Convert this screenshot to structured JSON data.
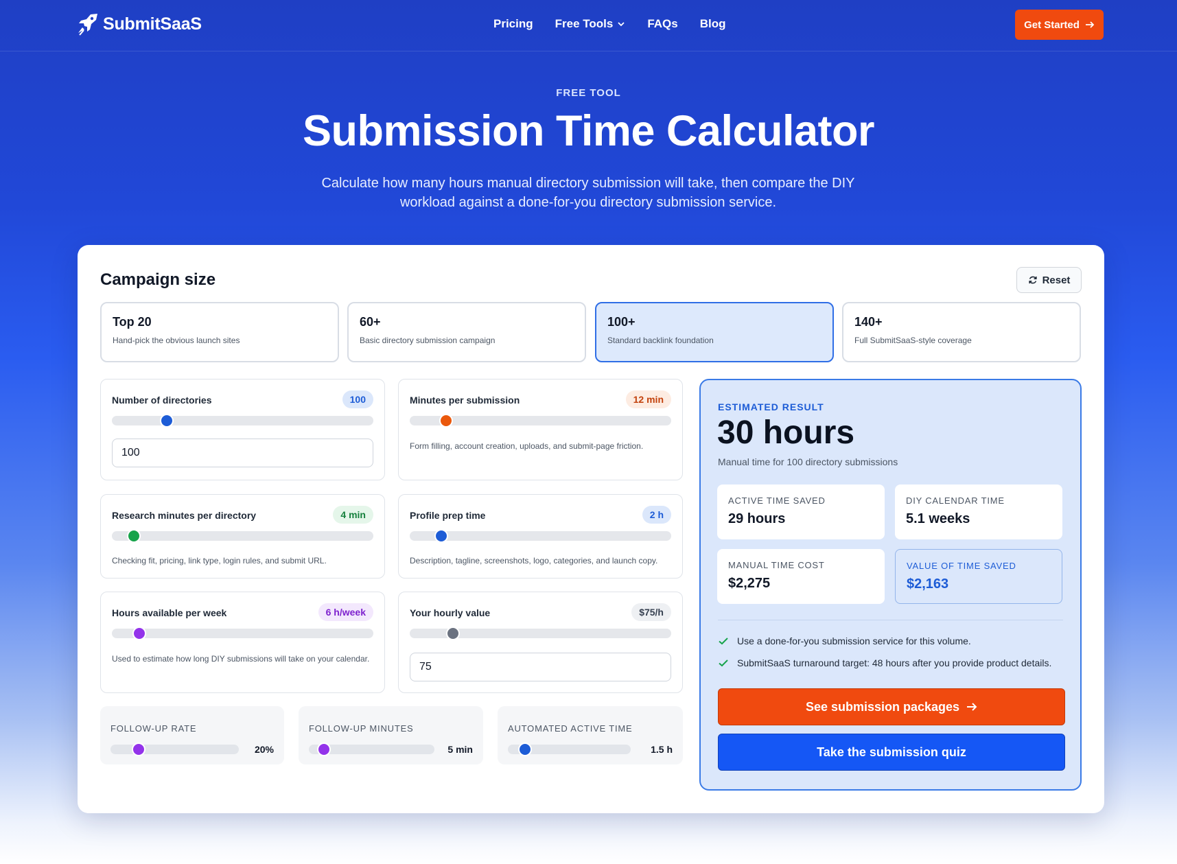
{
  "nav": {
    "logo_text": "SubmitSaaS",
    "links": [
      "Pricing",
      "Free Tools",
      "FAQs",
      "Blog"
    ],
    "cta": "Get Started"
  },
  "hero": {
    "eyebrow": "FREE TOOL",
    "title": "Submission Time Calculator",
    "subtitle": "Calculate how many hours manual directory submission will take, then compare the DIY workload against a done-for-you directory submission service."
  },
  "calculator": {
    "title": "Campaign size",
    "reset_label": "Reset",
    "presets": [
      {
        "title": "Top 20",
        "desc": "Hand-pick the obvious launch sites",
        "active": false
      },
      {
        "title": "60+",
        "desc": "Basic directory submission campaign",
        "active": false
      },
      {
        "title": "100+",
        "desc": "Standard backlink foundation",
        "active": true
      },
      {
        "title": "140+",
        "desc": "Full SubmitSaaS-style coverage",
        "active": false
      }
    ],
    "controls": {
      "directories": {
        "label": "Number of directories",
        "pill": "100",
        "input": "100",
        "level": 0.21,
        "color": "#1d5cd6"
      },
      "minutes": {
        "label": "Minutes per submission",
        "pill": "12 min",
        "help": "Form filling, account creation, uploads, and submit-page friction.",
        "level": 0.14,
        "color": "#ea580c"
      },
      "research": {
        "label": "Research minutes per directory",
        "pill": "4 min",
        "help": "Checking fit, pricing, link type, login rules, and submit URL.",
        "level": 0.085,
        "color": "#16a34a"
      },
      "profile": {
        "label": "Profile prep time",
        "pill": "2 h",
        "help": "Description, tagline, screenshots, logo, categories, and launch copy.",
        "level": 0.12,
        "color": "#1d5cd6"
      },
      "hours_week": {
        "label": "Hours available per week",
        "pill": "6 h/week",
        "help": "Used to estimate how long DIY submissions will take on your calendar.",
        "level": 0.105,
        "color": "#9333ea"
      },
      "hourly": {
        "label": "Your hourly value",
        "pill": "$75/h",
        "input": "75",
        "level": 0.165,
        "color": "#6b7280"
      }
    },
    "mini": [
      {
        "label": "FOLLOW-UP RATE",
        "value": "20%",
        "level": 0.22,
        "color": "#9333ea"
      },
      {
        "label": "FOLLOW-UP MINUTES",
        "value": "5 min",
        "level": 0.12,
        "color": "#9333ea"
      },
      {
        "label": "AUTOMATED ACTIVE TIME",
        "value": "1.5 h",
        "level": 0.14,
        "color": "#1d5cd6"
      }
    ]
  },
  "result": {
    "eyebrow": "ESTIMATED RESULT",
    "headline": "30 hours",
    "subtitle": "Manual time for 100 directory submissions",
    "stats": [
      {
        "label": "ACTIVE TIME SAVED",
        "value": "29 hours"
      },
      {
        "label": "DIY CALENDAR TIME",
        "value": "5.1 weeks"
      },
      {
        "label": "MANUAL TIME COST",
        "value": "$2,275"
      },
      {
        "label": "VALUE OF TIME SAVED",
        "value": "$2,163"
      }
    ],
    "checks": [
      "Use a done-for-you submission service for this volume.",
      "SubmitSaaS turnaround target: 48 hours after you provide product details."
    ],
    "primary_cta": "See submission packages",
    "secondary_cta": "Take the submission quiz"
  }
}
